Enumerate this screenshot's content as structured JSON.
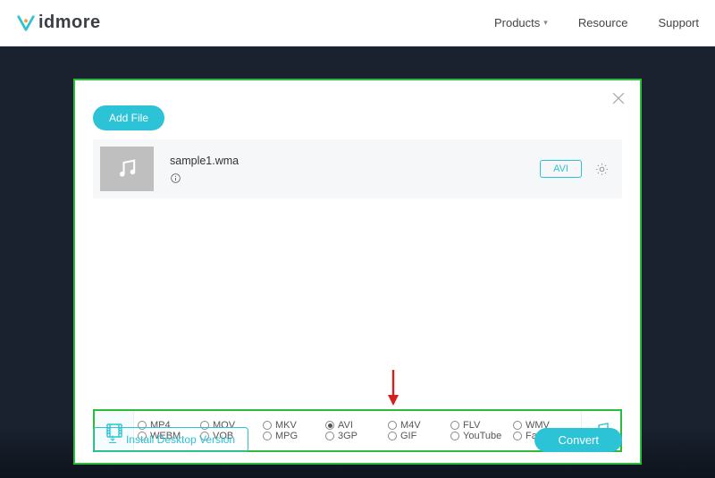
{
  "brand": "idmore",
  "nav": {
    "products": "Products",
    "resource": "Resource",
    "support": "Support"
  },
  "addFile": "Add File",
  "file": {
    "name": "sample1.wma",
    "format": "AVI"
  },
  "formats": {
    "row1": [
      "MP4",
      "MOV",
      "MKV",
      "AVI",
      "M4V",
      "FLV",
      "WMV"
    ],
    "row2": [
      "WEBM",
      "VOB",
      "MPG",
      "3GP",
      "GIF",
      "YouTube",
      "Facebook"
    ],
    "selected": "AVI"
  },
  "install": "Install Desktop Version",
  "convert": "Convert"
}
